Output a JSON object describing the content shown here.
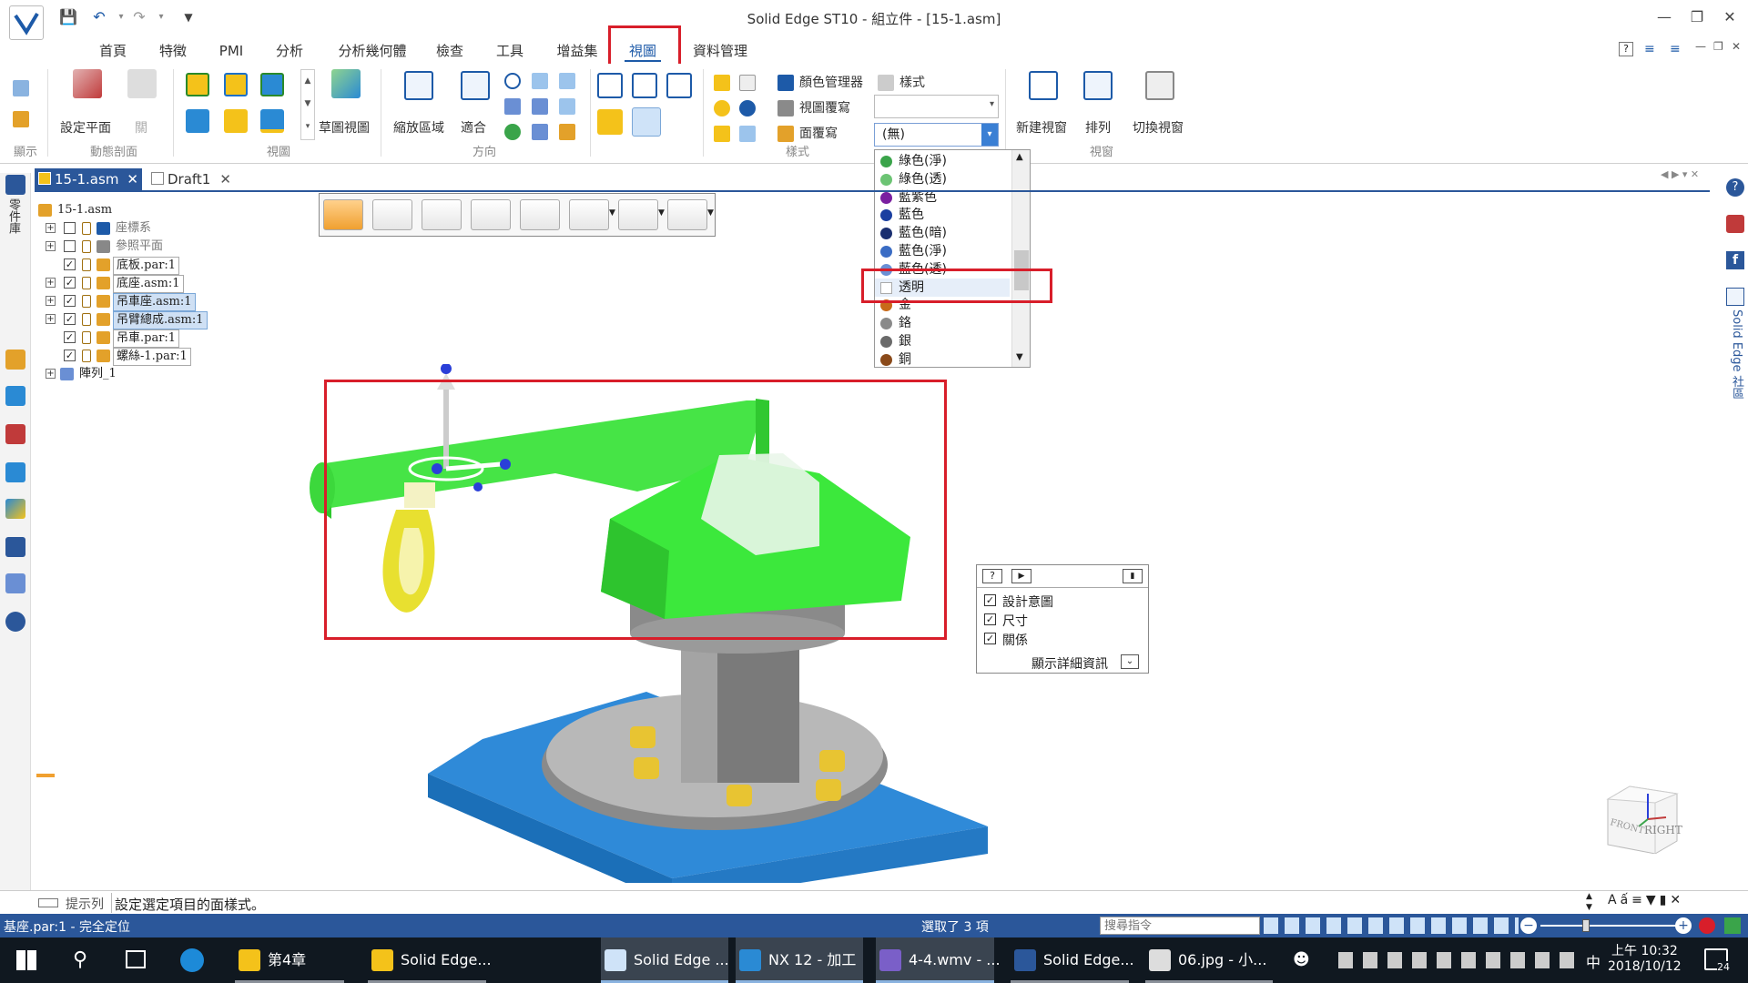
{
  "window": {
    "title": "Solid Edge ST10 - 組立件 - [15-1.asm]"
  },
  "ribbon_tabs": [
    "首頁",
    "特徵",
    "PMI",
    "分析",
    "分析幾何體",
    "檢查",
    "工具",
    "增益集",
    "視圖",
    "資料管理"
  ],
  "active_tab": "視圖",
  "ribbon": {
    "show_group": "顯示",
    "section_plane_label": "設定平面",
    "close_label": "關",
    "dynamic_section_group": "動態剖面",
    "view_group": "視圖",
    "sketch_view_label": "草圖視圖",
    "zoom_area_label": "縮放區域",
    "fit_label": "適合",
    "orient_group": "方向",
    "color_manager_label": "顏色管理器",
    "view_override_label": "視圖覆寫",
    "face_override_label": "面覆寫",
    "style_label": "樣式",
    "style_group": "樣式",
    "face_style_value": "(無)",
    "new_window_label": "新建視窗",
    "arrange_label": "排列",
    "switch_window_label": "切換視窗",
    "window_group": "視窗"
  },
  "dropdown": {
    "items": [
      {
        "label": "綠色(淨)",
        "color": "#3aa44a"
      },
      {
        "label": "綠色(透)",
        "color": "#6cc474"
      },
      {
        "label": "藍紫色",
        "color": "#7a1fa0"
      },
      {
        "label": "藍色",
        "color": "#1a3fa0"
      },
      {
        "label": "藍色(暗)",
        "color": "#1a2f70"
      },
      {
        "label": "藍色(淨)",
        "color": "#3a6cc4"
      },
      {
        "label": "藍色(透)",
        "color": "#6a8fd4"
      },
      {
        "label": "透明",
        "color": "#ffffff"
      },
      {
        "label": "金",
        "color": "#c86a1a"
      },
      {
        "label": "鉻",
        "color": "#8a8a8a"
      },
      {
        "label": "銀",
        "color": "#6a6a6a"
      },
      {
        "label": "銅",
        "color": "#8a4a1a"
      }
    ],
    "highlighted": "透明"
  },
  "doc_tabs": [
    {
      "label": "15-1.asm",
      "active": true
    },
    {
      "label": "Draft1",
      "active": false
    }
  ],
  "left_panel_label": "零件庫",
  "tree": [
    {
      "label": "15-1.asm",
      "level": 0
    },
    {
      "label": "座標系",
      "level": 1
    },
    {
      "label": "參照平面",
      "level": 1
    },
    {
      "label": "底板.par:1",
      "level": 1
    },
    {
      "label": "底座.asm:1",
      "level": 1
    },
    {
      "label": "吊車座.asm:1",
      "level": 1
    },
    {
      "label": "吊臂總成.asm:1",
      "level": 1
    },
    {
      "label": "吊車.par:1",
      "level": 1
    },
    {
      "label": "螺絲-1.par:1",
      "level": 1
    },
    {
      "label": "陣列_1",
      "level": 0
    }
  ],
  "info_panel": {
    "items": [
      "設計意圖",
      "尺寸",
      "關係"
    ],
    "details_button": "顯示詳細資訊"
  },
  "right_panel_label": "Solid Edge 社區",
  "view_cube": {
    "front": "FRONT",
    "right": "RIGHT"
  },
  "prompt": {
    "label": "提示列",
    "text": "設定選定項目的面樣式。"
  },
  "status": {
    "left": "基座.par:1 - 完全定位",
    "selection": "選取了 3 項",
    "search_placeholder": "搜尋指令"
  },
  "taskbar": {
    "apps": [
      "第4章",
      "Solid Edge...",
      "Solid Edge ...",
      "NX 12 - 加工",
      "4-4.wmv - ...",
      "Solid Edge...",
      "06.jpg - 小..."
    ],
    "ime": "中",
    "time": "上午 10:32",
    "date": "2018/10/12",
    "notifications": "24"
  }
}
